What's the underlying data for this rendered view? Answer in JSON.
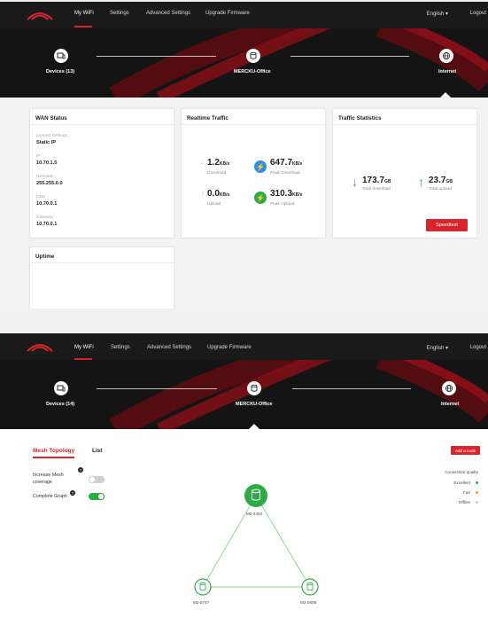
{
  "colors": {
    "accent": "#d9242c",
    "nav_bg": "#1a1a1a",
    "hero_bg": "#141414",
    "green": "#2faa47",
    "blue": "#2f8fe0"
  },
  "screen1": {
    "nav": {
      "items": [
        "My WiFi",
        "Settings",
        "Advanced Settings",
        "Upgrade Firmware"
      ],
      "language": "English",
      "logout": "Logout"
    },
    "hero": {
      "devices": "Devices (13)",
      "router": "MERCKU-Office",
      "internet": "Internet"
    },
    "wan": {
      "title": "WAN Status",
      "internet_settings_label": "Internet Settings :",
      "internet_settings_value": "Static IP",
      "ip_label": "IP :",
      "ip_value": "10.70.1.5",
      "netmask_label": "Netmask :",
      "netmask_value": "255.255.0.0",
      "dns_label": "DNS :",
      "dns_value": "10.70.0.1",
      "gateway_label": "Gateway :",
      "gateway_value": "10.70.0.1"
    },
    "realtime": {
      "title": "Realtime Traffic",
      "download_value": "1.2",
      "download_unit": "KB/s",
      "download_label": "Download",
      "upload_value": "0.0",
      "upload_unit": "KB/s",
      "upload_label": "Upload",
      "peak_download_value": "647.7",
      "peak_download_unit": "KB/s",
      "peak_download_label": "Peak Download",
      "peak_upload_value": "310.3",
      "peak_upload_unit": "KB/s",
      "peak_upload_label": "Peak Upload"
    },
    "stats": {
      "title": "Traffic Statistics",
      "total_download_value": "173.7",
      "total_download_unit": "GB",
      "total_download_label": "Total download",
      "total_upload_value": "23.7",
      "total_upload_unit": "GB",
      "total_upload_label": "Total upload",
      "speedtest": "Speedtest"
    },
    "uptime": {
      "title": "Uptime"
    }
  },
  "screen2": {
    "nav": {
      "items": [
        "My WiFi",
        "Settings",
        "Advanced Settings",
        "Upgrade Firmware"
      ],
      "language": "English",
      "logout": "Logout"
    },
    "hero": {
      "devices": "Devices (14)",
      "router": "MERCKU-Office",
      "internet": "Internet"
    },
    "tabs": [
      "Mesh Topology",
      "List"
    ],
    "options": {
      "increase_mesh_line1": "Increase Mesh",
      "increase_mesh_line2": "coverage",
      "increase_mesh_on": false,
      "complete_graph": "Complete Graph",
      "complete_graph_on": true
    },
    "add_node": "Add a node",
    "legend": {
      "title": "Connection quality",
      "items": [
        {
          "label": "Excellent",
          "color": "#2faa47"
        },
        {
          "label": "Fair",
          "color": "#f0a020"
        },
        {
          "label": "Offline",
          "color": "#cccccc"
        }
      ]
    },
    "mesh_nodes": {
      "top": "M0-3402",
      "left": "M2-0747",
      "right": "M2-0608"
    }
  }
}
